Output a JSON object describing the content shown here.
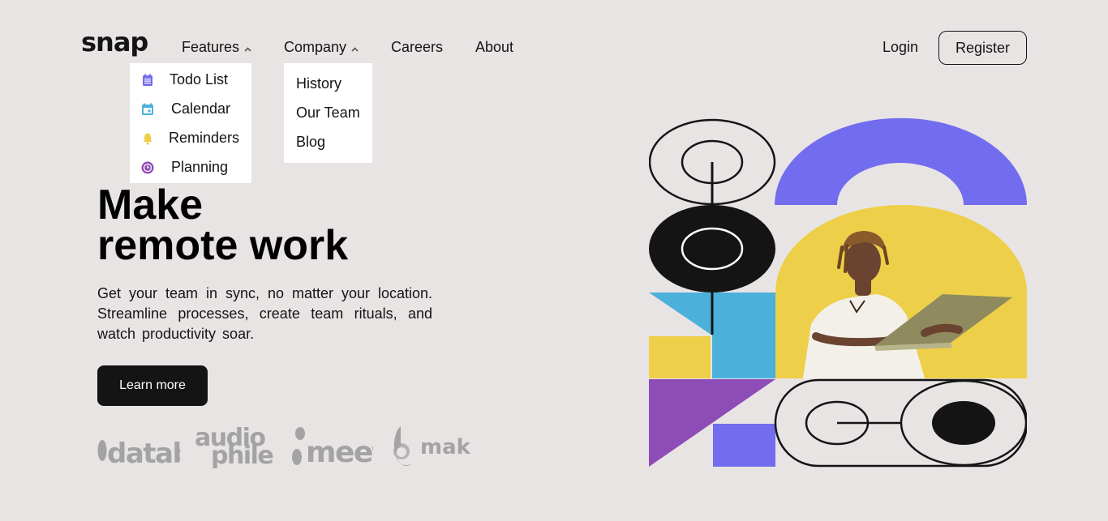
{
  "logo": "snap",
  "nav": {
    "features": "Features",
    "company": "Company",
    "careers": "Careers",
    "about": "About"
  },
  "features_menu": [
    {
      "label": "Todo List",
      "icon": "todo-icon",
      "color": "#726cee"
    },
    {
      "label": "Calendar",
      "icon": "calendar-icon",
      "color": "#4bb1da"
    },
    {
      "label": "Reminders",
      "icon": "bell-icon",
      "color": "#edcf49"
    },
    {
      "label": "Planning",
      "icon": "clock-icon",
      "color": "#8e4cb6"
    }
  ],
  "company_menu": [
    "History",
    "Our Team",
    "Blog"
  ],
  "auth": {
    "login": "Login",
    "register": "Register"
  },
  "hero": {
    "headline_line1": "Make",
    "headline_line2": "remote work",
    "subtext": "Get your team in sync, no matter your location. Streamline processes, create team rituals, and watch productivity soar.",
    "cta": "Learn more"
  },
  "clients": [
    {
      "name": "databiz"
    },
    {
      "name_line1": "audio",
      "name_line2": "phile"
    },
    {
      "name": "meet"
    },
    {
      "name": "maker"
    }
  ],
  "colors": {
    "background": "#e9e4e4",
    "purple": "#726cee",
    "blue": "#4bb1da",
    "yellow": "#edcf49",
    "violet": "#8e4cb6",
    "dark": "#141414"
  }
}
